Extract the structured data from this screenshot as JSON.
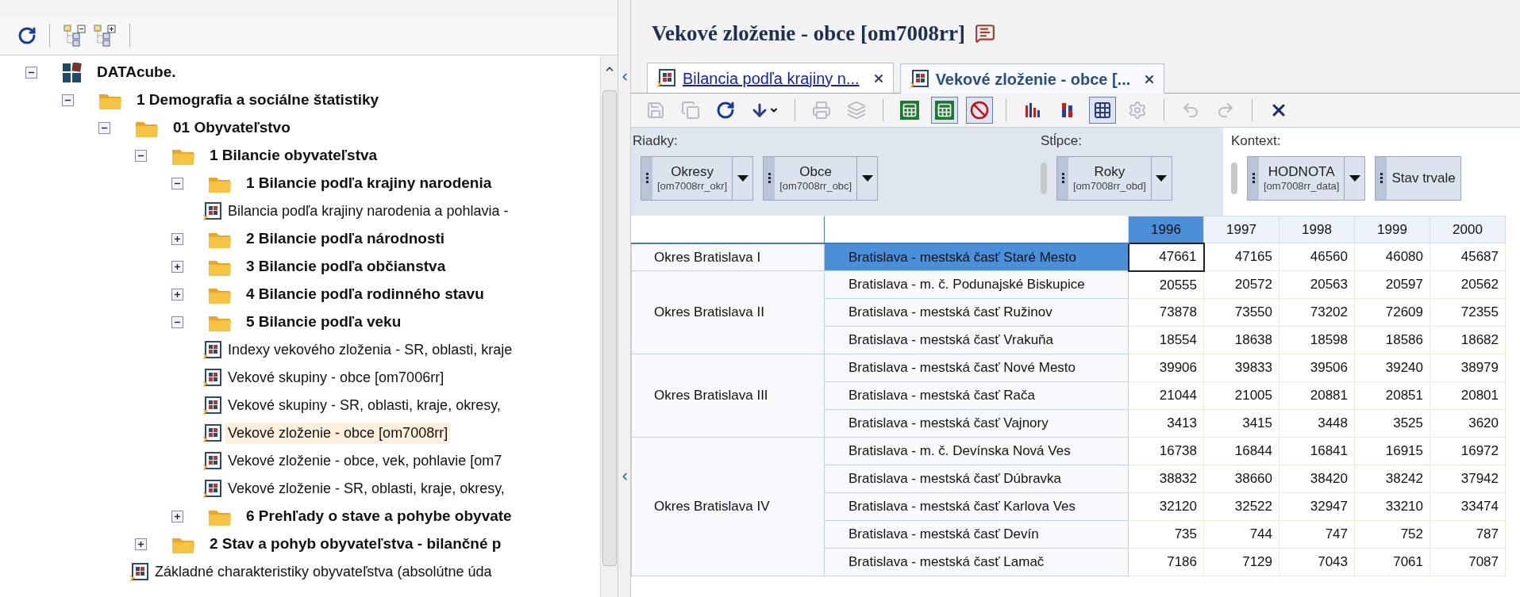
{
  "left_toolbar": [
    {
      "kind": "refresh"
    },
    {
      "kind": "separator"
    },
    {
      "kind": "collapse-tree"
    },
    {
      "kind": "expand-tree"
    },
    {
      "kind": "separator"
    }
  ],
  "tree": [
    {
      "kind": "root",
      "label": "DATAcube.",
      "expanded": true,
      "children": [
        {
          "kind": "folder",
          "label": "1 Demografia a sociálne štatistiky",
          "expanded": true,
          "children": [
            {
              "kind": "folder",
              "label": "01 Obyvateľstvo",
              "expanded": true,
              "children": [
                {
                  "kind": "folder",
                  "label": "1 Bilancie obyvateľstva",
                  "expanded": true,
                  "children": [
                    {
                      "kind": "folder",
                      "label": "1 Bilancie podľa krajiny narodenia",
                      "expanded": true,
                      "children": [
                        {
                          "kind": "report",
                          "label": "Bilancia podľa krajiny narodenia a pohlavia -",
                          "selected": false
                        }
                      ]
                    },
                    {
                      "kind": "folder",
                      "label": "2 Bilancie podľa národnosti",
                      "expanded": false
                    },
                    {
                      "kind": "folder",
                      "label": "3 Bilancie podľa občianstva",
                      "expanded": false
                    },
                    {
                      "kind": "folder",
                      "label": "4 Bilancie podľa rodinného stavu",
                      "expanded": false
                    },
                    {
                      "kind": "folder",
                      "label": "5 Bilancie podľa veku",
                      "expanded": true,
                      "children": [
                        {
                          "kind": "report",
                          "label": "Indexy vekového zloženia - SR, oblasti, kraje",
                          "selected": false
                        },
                        {
                          "kind": "report",
                          "label": "Vekové skupiny - obce [om7006rr]",
                          "selected": false
                        },
                        {
                          "kind": "report",
                          "label": "Vekové skupiny - SR, oblasti, kraje, okresy,",
                          "selected": false
                        },
                        {
                          "kind": "report",
                          "label": "Vekové zloženie - obce [om7008rr]",
                          "selected": true
                        },
                        {
                          "kind": "report",
                          "label": "Vekové zloženie - obce, vek, pohlavie [om7",
                          "selected": false
                        },
                        {
                          "kind": "report",
                          "label": "Vekové zloženie - SR, oblasti, kraje, okresy,",
                          "selected": false
                        }
                      ]
                    },
                    {
                      "kind": "folder",
                      "label": "6 Prehľady o stave a pohybe obyvate",
                      "expanded": false
                    }
                  ]
                },
                {
                  "kind": "folder",
                  "label": "2 Stav a pohyb obyvateľstva - bilančné p",
                  "expanded": false
                },
                {
                  "kind": "report",
                  "label": "Základné charakteristiky obyvateľstva (absolútne úda",
                  "selected": false
                }
              ]
            }
          ]
        }
      ]
    }
  ],
  "title": "Vekové zloženie - obce [om7008rr]",
  "tabs": [
    {
      "label": "Bilancia podľa krajiny n...",
      "selected": false
    },
    {
      "label": "Vekové zloženie - obce [...",
      "selected": true
    }
  ],
  "toolbar": [
    {
      "kind": "save",
      "disabled": true
    },
    {
      "kind": "copy",
      "disabled": true
    },
    {
      "kind": "refresh"
    },
    {
      "kind": "export"
    },
    {
      "kind": "separator"
    },
    {
      "kind": "print",
      "disabled": true
    },
    {
      "kind": "layers",
      "disabled": true
    },
    {
      "kind": "separator"
    },
    {
      "kind": "sheet",
      "pressed": false
    },
    {
      "kind": "sheet-edit",
      "pressed": true
    },
    {
      "kind": "no-zero",
      "pressed": true
    },
    {
      "kind": "separator"
    },
    {
      "kind": "bar-chart",
      "pressed": false
    },
    {
      "kind": "stacked-chart",
      "pressed": false
    },
    {
      "kind": "grid",
      "pressed": true
    },
    {
      "kind": "chart-settings",
      "disabled": true
    },
    {
      "kind": "separator"
    },
    {
      "kind": "undo",
      "disabled": true
    },
    {
      "kind": "redo",
      "disabled": true
    },
    {
      "kind": "separator"
    },
    {
      "kind": "close"
    }
  ],
  "pivot": {
    "rows_label": "Riadky:",
    "columns_label": "Stĺpce:",
    "context_label": "Kontext:",
    "rows": [
      {
        "name": "Okresy",
        "code": "[om7008rr_okr]"
      },
      {
        "name": "Obce",
        "code": "[om7008rr_obc]"
      }
    ],
    "columns": [
      {
        "name": "Roky",
        "code": "[om7008rr_obd]"
      }
    ],
    "context": [
      {
        "name": "HODNOTA",
        "code": "[om7008rr_data]"
      },
      {
        "name": "Stav trvale"
      }
    ]
  },
  "table": {
    "columns": [
      {
        "label": "1996",
        "selected": true
      },
      {
        "label": "1997",
        "selected": false
      },
      {
        "label": "1998",
        "selected": false
      },
      {
        "label": "1999",
        "selected": false
      },
      {
        "label": "2000",
        "selected": false
      }
    ],
    "groups": [
      {
        "okres": "Okres Bratislava I",
        "rows": [
          {
            "obec": "Bratislava - mestská časť Staré Mesto",
            "selected": true,
            "values": [
              "47661",
              "47165",
              "46560",
              "46080",
              "45687"
            ]
          }
        ]
      },
      {
        "okres": "Okres Bratislava II",
        "rows": [
          {
            "obec": "Bratislava - m. č. Podunajské Biskupice",
            "selected": false,
            "values": [
              "20555",
              "20572",
              "20563",
              "20597",
              "20562"
            ]
          },
          {
            "obec": "Bratislava - mestská časť Ružinov",
            "selected": false,
            "values": [
              "73878",
              "73550",
              "73202",
              "72609",
              "72355"
            ]
          },
          {
            "obec": "Bratislava - mestská časť Vrakuňa",
            "selected": false,
            "values": [
              "18554",
              "18638",
              "18598",
              "18586",
              "18682"
            ]
          }
        ]
      },
      {
        "okres": "Okres Bratislava III",
        "rows": [
          {
            "obec": "Bratislava - mestská časť Nové Mesto",
            "selected": false,
            "values": [
              "39906",
              "39833",
              "39506",
              "39240",
              "38979"
            ]
          },
          {
            "obec": "Bratislava - mestská časť Rača",
            "selected": false,
            "values": [
              "21044",
              "21005",
              "20881",
              "20851",
              "20801"
            ]
          },
          {
            "obec": "Bratislava - mestská časť Vajnory",
            "selected": false,
            "values": [
              "3413",
              "3415",
              "3448",
              "3525",
              "3620"
            ]
          }
        ]
      },
      {
        "okres": "Okres Bratislava IV",
        "rows": [
          {
            "obec": "Bratislava - m. č. Devínska Nová Ves",
            "selected": false,
            "values": [
              "16738",
              "16844",
              "16841",
              "16915",
              "16972"
            ]
          },
          {
            "obec": "Bratislava - mestská časť Dúbravka",
            "selected": false,
            "values": [
              "38832",
              "38660",
              "38420",
              "38242",
              "37942"
            ]
          },
          {
            "obec": "Bratislava - mestská časť Karlova Ves",
            "selected": false,
            "values": [
              "32120",
              "32522",
              "32947",
              "33210",
              "33474"
            ]
          },
          {
            "obec": "Bratislava - mestská časť Devín",
            "selected": false,
            "values": [
              "735",
              "744",
              "747",
              "752",
              "787"
            ]
          },
          {
            "obec": "Bratislava - mestská časť Lamač",
            "selected": false,
            "values": [
              "7186",
              "7129",
              "7043",
              "7061",
              "7087"
            ]
          }
        ]
      }
    ]
  }
}
